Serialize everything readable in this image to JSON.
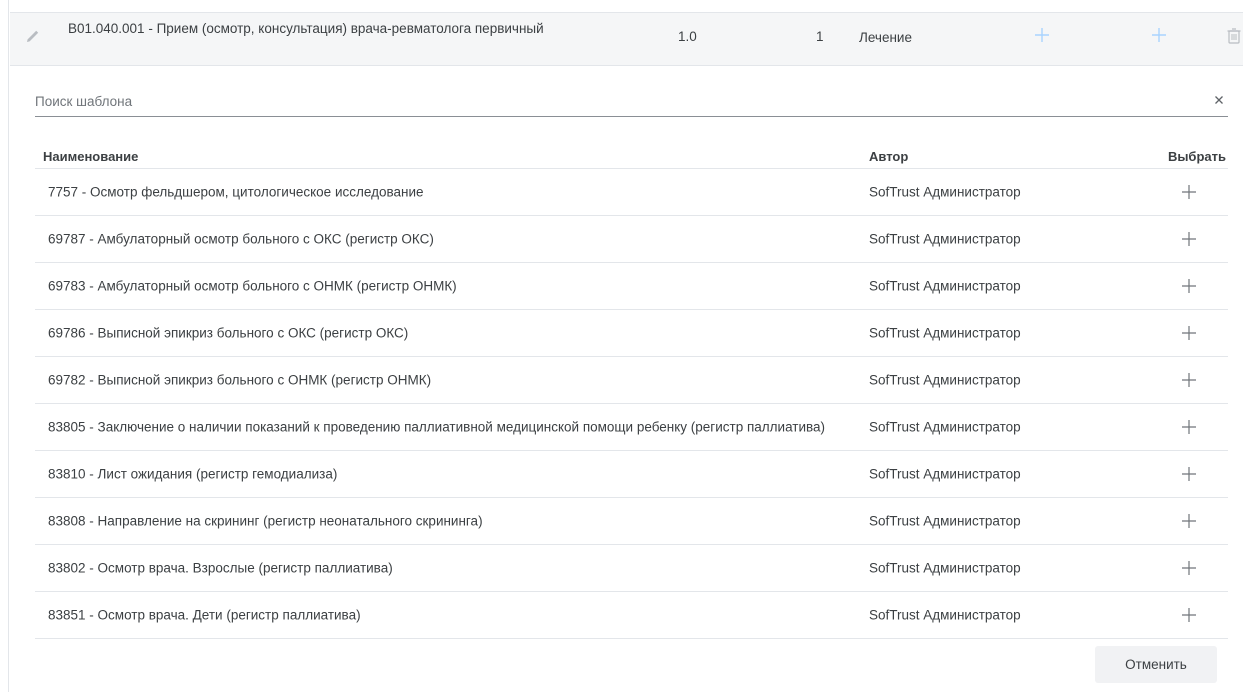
{
  "service_row": {
    "name": "B01.040.001 - Прием (осмотр, консультация) врача-ревматолога первичный",
    "quantity": "1.0",
    "count": "1",
    "type": "Лечение",
    "icons": [
      "pencil-icon",
      "plus-icon",
      "plus-icon",
      "trash-icon"
    ]
  },
  "search": {
    "placeholder": "Поиск шаблона",
    "value": ""
  },
  "table": {
    "headers": {
      "name": "Наименование",
      "author": "Автор",
      "select": "Выбрать"
    },
    "rows": [
      {
        "name": "7757 - Осмотр фельдшером, цитологическое исследование",
        "author": "SofTrust Администратор"
      },
      {
        "name": "69787 - Амбулаторный осмотр больного с ОКС (регистр ОКС)",
        "author": "SofTrust Администратор"
      },
      {
        "name": "69783 - Амбулаторный осмотр больного с ОНМК (регистр ОНМК)",
        "author": "SofTrust Администратор"
      },
      {
        "name": "69786 - Выписной эпикриз больного с ОКС (регистр ОКС)",
        "author": "SofTrust Администратор"
      },
      {
        "name": "69782 - Выписной эпикриз больного с ОНМК (регистр ОНМК)",
        "author": "SofTrust Администратор"
      },
      {
        "name": "83805 - Заключение о наличии показаний к проведению паллиативной медицинской помощи ребенку (регистр паллиатива)",
        "author": "SofTrust Администратор"
      },
      {
        "name": "83810 - Лист ожидания (регистр гемодиализа)",
        "author": "SofTrust Администратор"
      },
      {
        "name": "83808 - Направление на скрининг (регистр неонатального скрининга)",
        "author": "SofTrust Администратор"
      },
      {
        "name": "83802 - Осмотр врача. Взрослые (регистр паллиатива)",
        "author": "SofTrust Администратор"
      },
      {
        "name": "83851 - Осмотр врача. Дети (регистр паллиатива)",
        "author": "SofTrust Администратор"
      }
    ]
  },
  "footer": {
    "cancel_label": "Отменить"
  },
  "colors": {
    "accent_light": "#a9d4ff",
    "text": "#3c4043",
    "divider": "#e3e6ea",
    "row_bg": "#f5f6f7",
    "button_bg": "#f1f2f4"
  }
}
